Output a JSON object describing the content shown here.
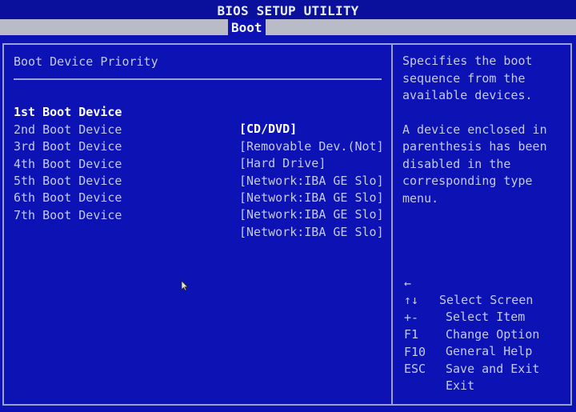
{
  "window": {
    "title": "BIOS SETUP UTILITY"
  },
  "menu": {
    "tabs": [
      {
        "label": "Boot",
        "active": true
      }
    ]
  },
  "colors": {
    "background": "#0c12b4",
    "menu_bar": "#b9bcc8",
    "text": "#c4cae8",
    "highlight_text": "#ffffff",
    "border": "#9aa2d8"
  },
  "main": {
    "section_title": "Boot Device Priority",
    "boot_devices": [
      {
        "label": "1st Boot Device",
        "value": "[CD/DVD]",
        "selected": true
      },
      {
        "label": "2nd Boot Device",
        "value": "[Removable Dev.(Not]",
        "selected": false
      },
      {
        "label": "3rd Boot Device",
        "value": "[Hard Drive]",
        "selected": false
      },
      {
        "label": "4th Boot Device",
        "value": "[Network:IBA GE Slo]",
        "selected": false
      },
      {
        "label": "5th Boot Device",
        "value": "[Network:IBA GE Slo]",
        "selected": false
      },
      {
        "label": "6th Boot Device",
        "value": "[Network:IBA GE Slo]",
        "selected": false
      },
      {
        "label": "7th Boot Device",
        "value": "[Network:IBA GE Slo]",
        "selected": false
      }
    ]
  },
  "help": {
    "paragraph1": [
      "Specifies the boot",
      "sequence from the",
      "available devices."
    ],
    "paragraph2": [
      "A device enclosed in",
      "parenthesis has been",
      "disabled in the",
      "corresponding type",
      "menu."
    ]
  },
  "keys": [
    {
      "key": "←",
      "desc": "Select Screen"
    },
    {
      "key": "↑↓",
      "desc": "Select Item"
    },
    {
      "key": "+-",
      "desc": "Change Option"
    },
    {
      "key": "F1",
      "desc": "General Help"
    },
    {
      "key": "F10",
      "desc": "Save and Exit"
    },
    {
      "key": "ESC",
      "desc": "Exit"
    }
  ],
  "icons": {
    "cursor": "mouse-pointer-icon"
  }
}
